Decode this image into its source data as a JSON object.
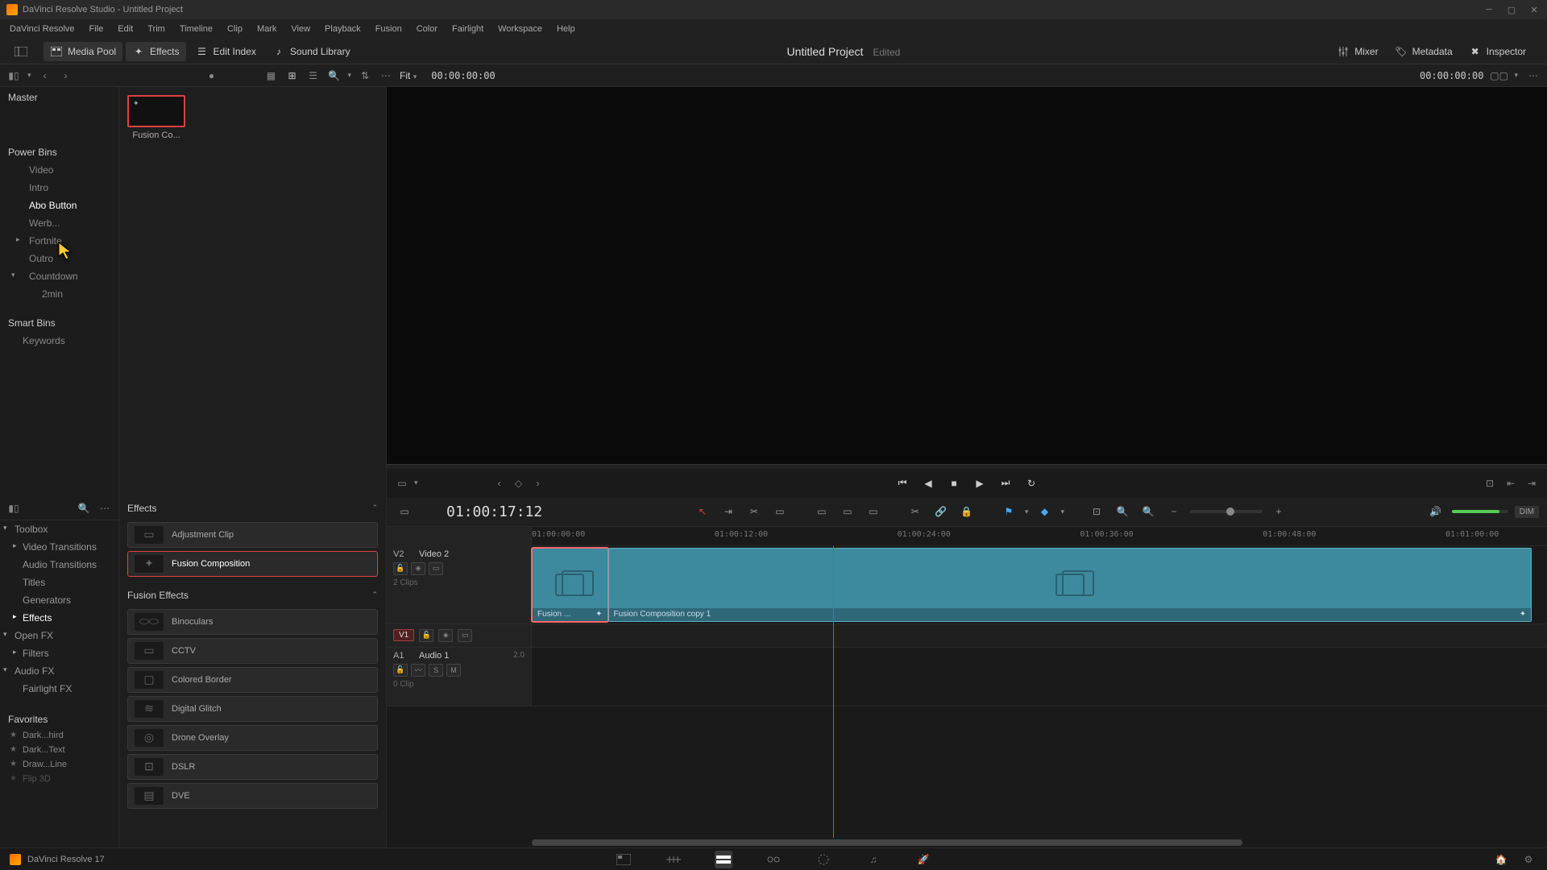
{
  "titlebar": {
    "text": "DaVinci Resolve Studio - Untitled Project"
  },
  "menu": [
    "DaVinci Resolve",
    "File",
    "Edit",
    "Trim",
    "Timeline",
    "Clip",
    "Mark",
    "View",
    "Playback",
    "Fusion",
    "Color",
    "Fairlight",
    "Workspace",
    "Help"
  ],
  "toolbar": {
    "mediaPool": "Media Pool",
    "effects": "Effects",
    "editIndex": "Edit Index",
    "soundLibrary": "Sound Library",
    "projectTitle": "Untitled Project",
    "edited": "Edited",
    "mixer": "Mixer",
    "metadata": "Metadata",
    "inspector": "Inspector"
  },
  "subbar": {
    "fit": "Fit",
    "tc": "00:00:00:00",
    "tcRight": "00:00:00:00"
  },
  "bins": {
    "master": "Master",
    "powerBins": "Power Bins",
    "items": [
      "Video",
      "Intro",
      "Abo Button",
      "Werb...",
      "Fortnite",
      "Outro",
      "Countdown"
    ],
    "sub": "2min",
    "smartBins": "Smart Bins",
    "keywords": "Keywords"
  },
  "pool": {
    "clipName": "Fusion Co..."
  },
  "effectsTree": {
    "toolbox": "Toolbox",
    "items": [
      "Video Transitions",
      "Audio Transitions",
      "Titles",
      "Generators",
      "Effects"
    ],
    "openfx": "Open FX",
    "filters": "Filters",
    "audiofx": "Audio FX",
    "fairlight": "Fairlight FX",
    "favorites": "Favorites",
    "favItems": [
      "Dark...hird",
      "Dark...Text",
      "Draw...Line",
      "Flip 3D"
    ]
  },
  "effectsList": {
    "group1": "Effects",
    "adjClip": "Adjustment Clip",
    "fusionComp": "Fusion Composition",
    "group2": "Fusion Effects",
    "items": [
      "Binoculars",
      "CCTV",
      "Colored Border",
      "Digital Glitch",
      "Drone Overlay",
      "DSLR",
      "DVE"
    ]
  },
  "timeline": {
    "tc": "01:00:17:12",
    "ruler": [
      "01:00:00:00",
      "01:00:12:00",
      "01:00:24:00",
      "01:00:36:00",
      "01:00:48:00",
      "01:01:00:00"
    ],
    "v2": {
      "label": "V2",
      "name": "Video 2",
      "clips": "2 Clips"
    },
    "v1": {
      "label": "V1"
    },
    "a1": {
      "label": "A1",
      "name": "Audio 1",
      "ch": "2.0",
      "clips": "0 Clip"
    },
    "clip1": "Fusion ...",
    "clip2": "Fusion Composition copy 1",
    "dim": "DIM"
  },
  "footer": {
    "version": "DaVinci Resolve 17"
  }
}
